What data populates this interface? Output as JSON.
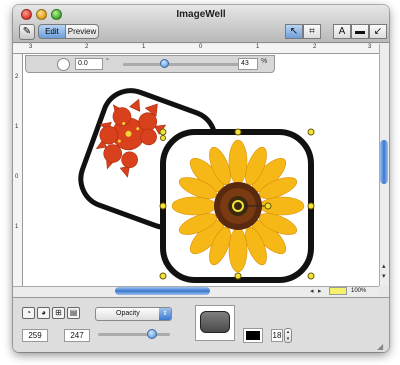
{
  "window": {
    "title": "ImageWell"
  },
  "toolbar": {
    "edit_label": "Edit",
    "preview_label": "Preview",
    "tools": [
      {
        "name": "pointer-tool",
        "glyph": "↖",
        "active": true
      },
      {
        "name": "crop-tool",
        "glyph": "⌗",
        "active": false
      },
      {
        "name": "text-tool",
        "glyph": "A",
        "active": false
      },
      {
        "name": "shape-tool",
        "glyph": "▬",
        "active": false
      },
      {
        "name": "line-tool",
        "glyph": "↙",
        "active": false
      }
    ]
  },
  "ruler": {
    "h_ticks": [
      "3",
      "2",
      "1",
      "0",
      "1",
      "2",
      "3"
    ],
    "v_ticks": [
      "2",
      "1",
      "0",
      "1"
    ]
  },
  "rotation_bar": {
    "angle": "0.0",
    "degree_symbol": "°",
    "percent": "43",
    "percent_unit": "%",
    "slider_fraction": 0.3
  },
  "scroll": {
    "left_arrow": "◂",
    "right_arrow": "▸",
    "up_arrow": "▴",
    "down_arrow": "▾",
    "zoom": "100%",
    "zoom_color": "#f4f26a"
  },
  "bottom_panel": {
    "shape_icons": [
      "◔",
      "◕",
      "⊞",
      "▤"
    ],
    "x_value": "259",
    "y_value": "247",
    "effect_select": "Opacity",
    "opacity_fraction": 0.75,
    "stroke_color": "#000000",
    "stroke_size": "18"
  },
  "colors": {
    "accent": "#3c78cf",
    "handle": "#f2e23a",
    "sunflower": "#f6b817",
    "lily": "#d9411c"
  }
}
